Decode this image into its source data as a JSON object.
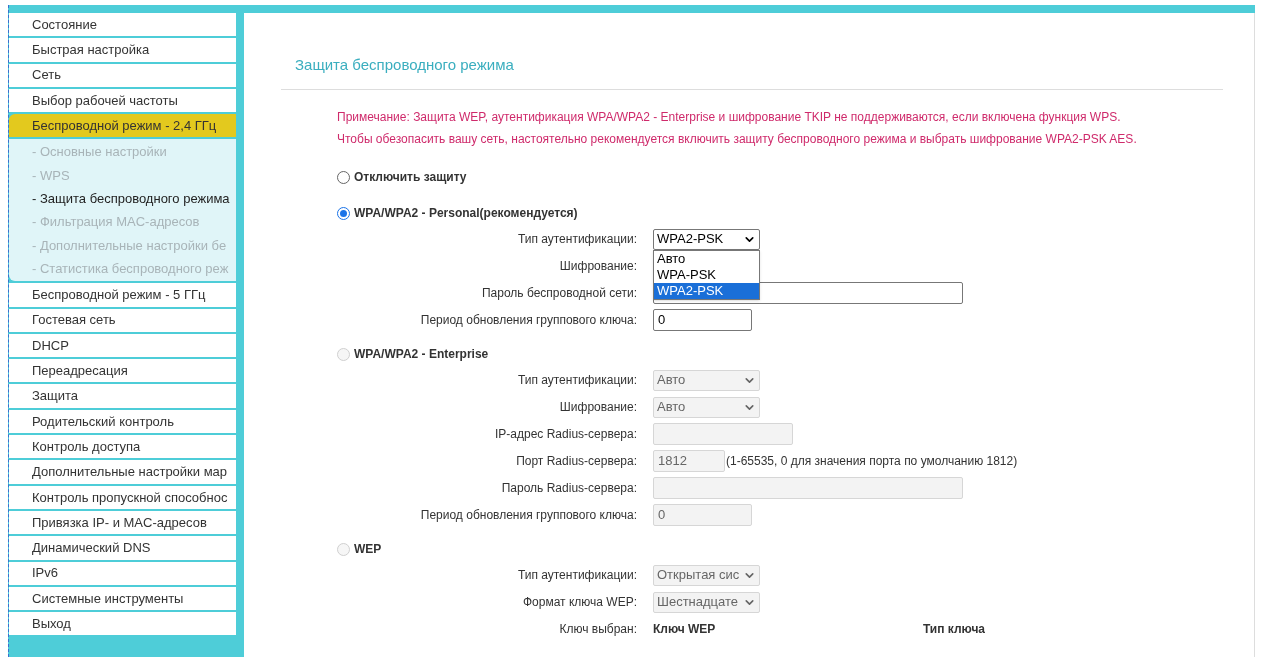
{
  "sidebar": {
    "items": [
      {
        "label": "Состояние",
        "selected": false
      },
      {
        "label": "Быстрая настройка",
        "selected": false
      },
      {
        "label": "Сеть",
        "selected": false
      },
      {
        "label": "Выбор рабочей частоты",
        "selected": false
      },
      {
        "label": "Беспроводной режим - 2,4 ГГц",
        "selected": true,
        "children": [
          {
            "label": "- Основные настройки",
            "selected": false
          },
          {
            "label": "- WPS",
            "selected": false
          },
          {
            "label": "- Защита беспроводного режима",
            "selected": true
          },
          {
            "label": "- Фильтрация MAC-адресов",
            "selected": false
          },
          {
            "label": "- Дополнительные настройки бе",
            "selected": false
          },
          {
            "label": "- Статистика беспроводного реж",
            "selected": false
          }
        ]
      },
      {
        "label": "Беспроводной режим - 5 ГГц",
        "selected": false
      },
      {
        "label": "Гостевая сеть",
        "selected": false
      },
      {
        "label": "DHCP",
        "selected": false
      },
      {
        "label": "Переадресация",
        "selected": false
      },
      {
        "label": "Защита",
        "selected": false
      },
      {
        "label": "Родительский контроль",
        "selected": false
      },
      {
        "label": "Контроль доступа",
        "selected": false
      },
      {
        "label": "Дополнительные настройки мар",
        "selected": false
      },
      {
        "label": "Контроль пропускной способнос",
        "selected": false
      },
      {
        "label": "Привязка IP- и MAC-адресов",
        "selected": false
      },
      {
        "label": "Динамический DNS",
        "selected": false
      },
      {
        "label": "IPv6",
        "selected": false
      },
      {
        "label": "Системные инструменты",
        "selected": false
      },
      {
        "label": "Выход",
        "selected": false
      }
    ]
  },
  "page": {
    "title": "Защита беспроводного режима",
    "notes": [
      "Примечание: Защита WEP, аутентификация WPA/WPA2 - Enterprise и шифрование TKIP не поддерживаются, если включена функция WPS.",
      "Чтобы обезопасить вашу сеть, настоятельно рекомендуется включить защиту беспроводного режима и выбрать шифрование WPA2-PSK AES."
    ],
    "sections": [
      {
        "label": "Отключить защиту",
        "selected": false,
        "disabled": false
      },
      {
        "label": "WPA/WPA2 - Personal(рекомендуется)",
        "selected": true,
        "disabled": false,
        "fields": [
          {
            "kind": "select",
            "label": "Тип аутентификации:",
            "value": "WPA2-PSK",
            "expanded": true,
            "options": [
              {
                "label": "Авто",
                "selected": false
              },
              {
                "label": "WPA-PSK",
                "selected": false
              },
              {
                "label": "WPA2-PSK",
                "selected": true
              }
            ]
          },
          {
            "kind": "select",
            "label": "Шифрование:"
          },
          {
            "kind": "wide_input",
            "label": "Пароль беспроводной сети:"
          },
          {
            "kind": "input",
            "label": "Период обновления группового ключа:",
            "value": "0"
          }
        ]
      },
      {
        "label": "WPA/WPA2 - Enterprise",
        "selected": false,
        "disabled": true,
        "fields": [
          {
            "kind": "select",
            "label": "Тип аутентификации:",
            "value": "Авто"
          },
          {
            "kind": "select",
            "label": "Шифрование:",
            "value": "Авто"
          },
          {
            "kind": "medium_input",
            "label": "IP-адрес Radius-сервера:"
          },
          {
            "kind": "short_input",
            "label": "Порт Radius-сервера:",
            "value": "1812",
            "hint": "(1-65535, 0 для значения порта по умолчанию 1812)"
          },
          {
            "kind": "wide_input",
            "label": "Пароль Radius-сервера:"
          },
          {
            "kind": "input",
            "label": "Период обновления группового ключа:",
            "value": "0"
          }
        ]
      },
      {
        "label": "WEP",
        "selected": false,
        "disabled": true,
        "fields": [
          {
            "kind": "select",
            "label": "Тип аутентификации:",
            "value": "Открытая сис"
          },
          {
            "kind": "select",
            "label": "Формат ключа WEP:",
            "value": "Шестнадцате"
          },
          {
            "kind": "header",
            "label": "Ключ выбран:",
            "columns": [
              "Ключ WEP",
              "Тип ключа"
            ]
          }
        ]
      }
    ]
  }
}
